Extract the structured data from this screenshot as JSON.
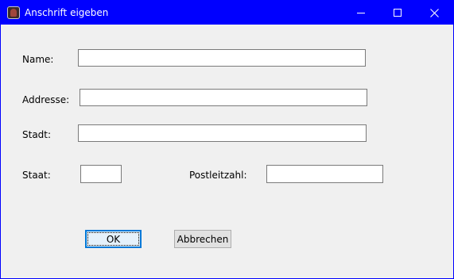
{
  "window": {
    "title": "Anschrift eigeben",
    "accent_color": "#0000ff",
    "icon": "app-icon"
  },
  "titlebar_buttons": {
    "minimize": "minimize-icon",
    "maximize": "maximize-icon",
    "close": "close-icon"
  },
  "form": {
    "name_label": "Name:",
    "name_value": "",
    "address_label": "Addresse:",
    "address_value": "",
    "city_label": "Stadt:",
    "city_value": "",
    "state_label": "Staat:",
    "state_value": "",
    "zip_label": "Postleitzahl:",
    "zip_value": ""
  },
  "buttons": {
    "ok_label": "OK",
    "cancel_label": "Abbrechen"
  }
}
